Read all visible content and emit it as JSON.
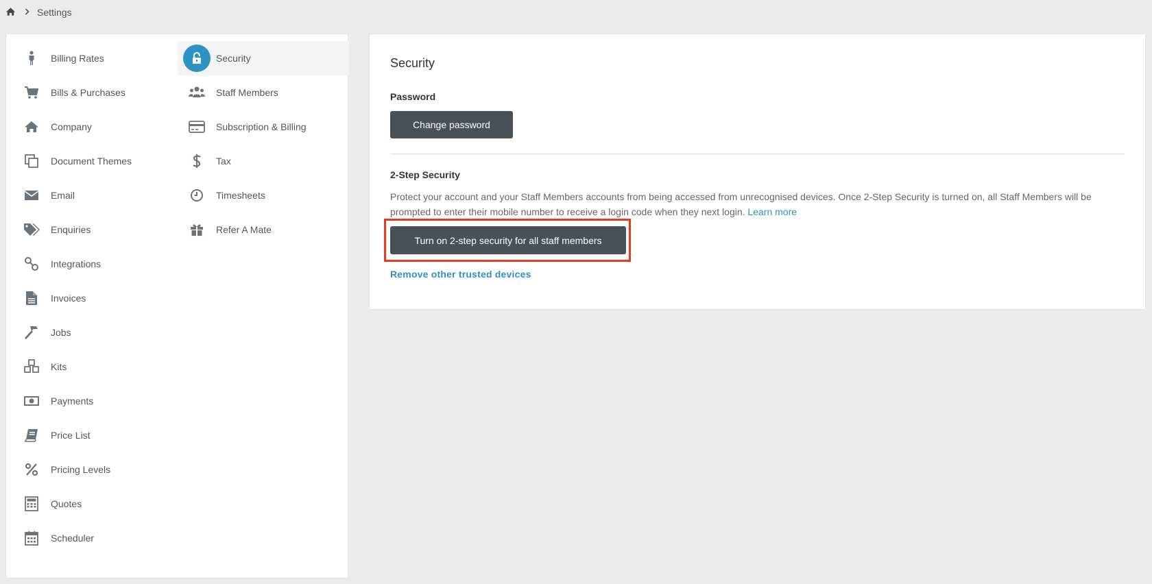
{
  "breadcrumb": {
    "home_icon": "home-icon",
    "separator_icon": "chevron-right-icon",
    "current": "Settings"
  },
  "menu": {
    "column1": [
      {
        "label": "Billing Rates",
        "icon": "person-icon"
      },
      {
        "label": "Bills & Purchases",
        "icon": "cart-icon"
      },
      {
        "label": "Company",
        "icon": "home-icon"
      },
      {
        "label": "Document Themes",
        "icon": "copy-icon"
      },
      {
        "label": "Email",
        "icon": "envelope-icon"
      },
      {
        "label": "Enquiries",
        "icon": "tags-icon"
      },
      {
        "label": "Integrations",
        "icon": "link-icon"
      },
      {
        "label": "Invoices",
        "icon": "file-icon"
      },
      {
        "label": "Jobs",
        "icon": "hammer-icon"
      },
      {
        "label": "Kits",
        "icon": "cubes-icon"
      },
      {
        "label": "Payments",
        "icon": "money-icon"
      },
      {
        "label": "Price List",
        "icon": "book-icon"
      },
      {
        "label": "Pricing Levels",
        "icon": "percent-icon"
      },
      {
        "label": "Quotes",
        "icon": "calculator-icon"
      },
      {
        "label": "Scheduler",
        "icon": "calendar-icon"
      }
    ],
    "column2": [
      {
        "label": "Security",
        "icon": "unlock-icon",
        "active": true
      },
      {
        "label": "Staff Members",
        "icon": "users-icon"
      },
      {
        "label": "Subscription & Billing",
        "icon": "credit-card-icon"
      },
      {
        "label": "Tax",
        "icon": "dollar-icon"
      },
      {
        "label": "Timesheets",
        "icon": "clock-icon"
      },
      {
        "label": "Refer A Mate",
        "icon": "gift-icon"
      }
    ]
  },
  "security": {
    "title": "Security",
    "password_label": "Password",
    "change_password_button": "Change password",
    "two_step_label": "2-Step Security",
    "two_step_description": "Protect your account and your Staff Members accounts from being accessed from unrecognised devices. Once 2-Step Security is turned on, all Staff Members will be prompted to enter their mobile number to receive a login code when they next login.",
    "learn_more_link": "Learn more",
    "enable_two_step_button": "Turn on 2-step security for all staff members",
    "remove_devices_link": "Remove other trusted devices"
  },
  "colors": {
    "accent": "#2e93c3",
    "button_dark": "#4a5058",
    "highlight": "#e8391e",
    "background": "#ebebeb"
  }
}
